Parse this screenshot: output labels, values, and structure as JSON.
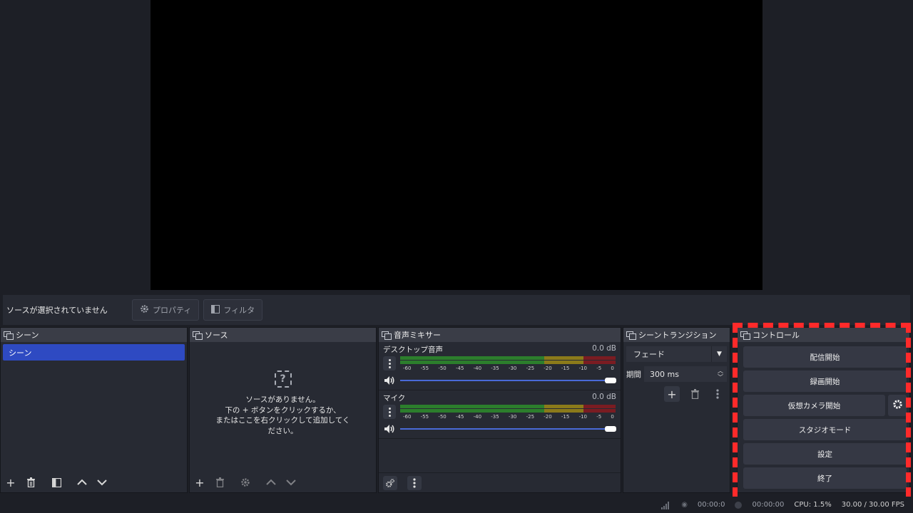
{
  "source_toolbar": {
    "no_source": "ソースが選択されていません",
    "properties": "プロパティ",
    "filters": "フィルタ"
  },
  "scenes": {
    "title": "シーン",
    "items": [
      "シーン"
    ]
  },
  "sources": {
    "title": "ソース",
    "empty_line1": "ソースがありません。",
    "empty_line2": "下の + ボタンをクリックするか、",
    "empty_line3": "またはここを右クリックして追加してく",
    "empty_line4": "ださい。"
  },
  "mixer": {
    "title": "音声ミキサー",
    "channels": [
      {
        "name": "デスクトップ音声",
        "db": "0.0 dB",
        "volume": 1.0
      },
      {
        "name": "マイク",
        "db": "0.0 dB",
        "volume": 1.0
      }
    ],
    "ticks": [
      "-60",
      "-55",
      "-50",
      "-45",
      "-40",
      "-35",
      "-30",
      "-25",
      "-20",
      "-15",
      "-10",
      "-5",
      "0"
    ]
  },
  "transitions": {
    "title": "シーントランジション",
    "selected": "フェード",
    "duration_label": "期間",
    "duration_value": "300 ms"
  },
  "controls": {
    "title": "コントロール",
    "start_streaming": "配信開始",
    "start_recording": "録画開始",
    "start_virtual_camera": "仮想カメラ開始",
    "studio_mode": "スタジオモード",
    "settings": "設定",
    "exit": "終了"
  },
  "status": {
    "stream_time": "00:00:0",
    "record_time": "00:00:00",
    "cpu": "CPU: 1.5%",
    "fps": "30.00 / 30.00 FPS"
  },
  "colors": {
    "accent": "#2e4ac2",
    "highlight": "#ff2a2a"
  }
}
